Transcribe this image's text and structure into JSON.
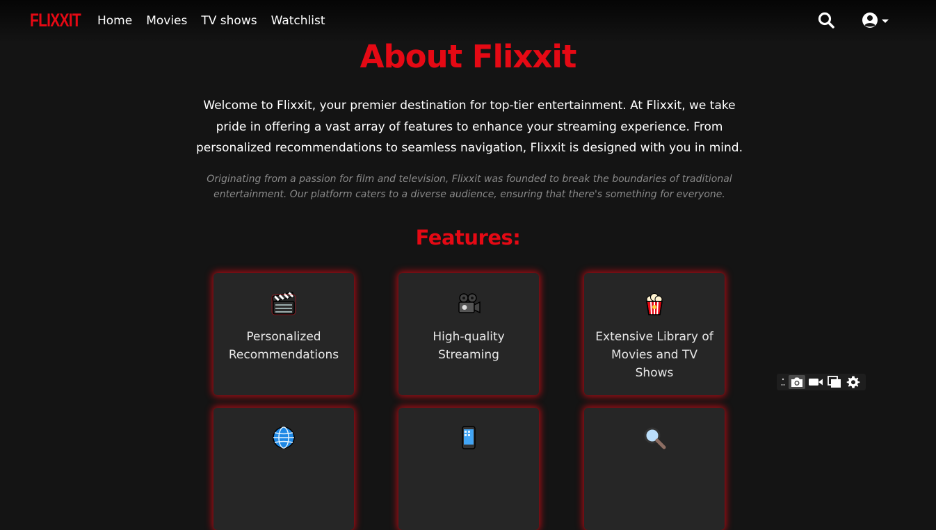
{
  "nav": {
    "logo": "FLIXXIT",
    "links": [
      "Home",
      "Movies",
      "TV shows",
      "Watchlist"
    ]
  },
  "about": {
    "title": "About Flixxit",
    "intro": "Welcome to Flixxit, your premier destination for top-tier entertainment. At Flixxit, we take pride in offering a vast array of features to enhance your streaming experience. From personalized recommendations to seamless navigation, Flixxit is designed with you in mind.",
    "origin": "Originating from a passion for film and television, Flixxit was founded to break the boundaries of traditional entertainment. Our platform caters to a diverse audience, ensuring that there's something for everyone."
  },
  "features": {
    "title": "Features:",
    "cards": [
      {
        "icon": "clapper-board-icon",
        "label": "Personalized Recommendations"
      },
      {
        "icon": "movie-camera-icon",
        "label": "High-quality Streaming"
      },
      {
        "icon": "popcorn-icon",
        "label": "Extensive Library of Movies and TV Shows"
      },
      {
        "icon": "globe-icon",
        "label": ""
      },
      {
        "icon": "mobile-phone-icon",
        "label": ""
      },
      {
        "icon": "magnifying-glass-icon",
        "label": ""
      }
    ]
  },
  "toolbar": {
    "icons": [
      "more-dots-icon",
      "camera-icon",
      "video-camera-icon",
      "copy-icon",
      "gear-icon"
    ]
  },
  "colors": {
    "brand": "#e50914",
    "background": "#141414",
    "card": "#262626",
    "muted_text": "#8a8a8a"
  }
}
